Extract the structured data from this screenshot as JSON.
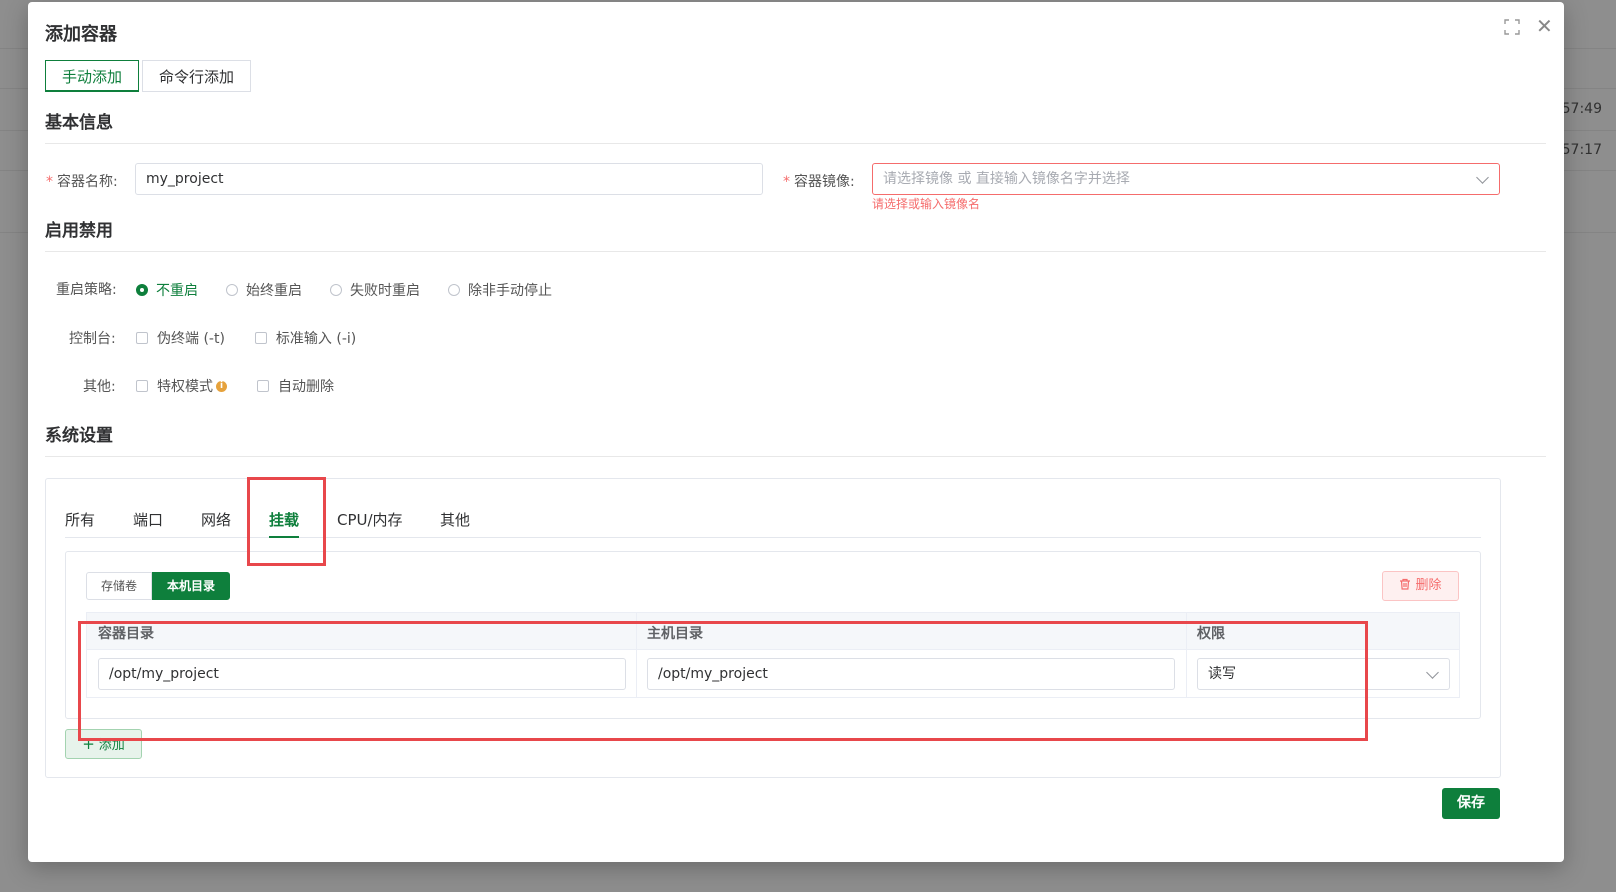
{
  "background": {
    "times": [
      "5:57:49",
      "5:57:17"
    ]
  },
  "dialog": {
    "title": "添加容器",
    "close_icon": "close-icon",
    "fullscreen_icon": "fullscreen-icon",
    "mode_tabs": [
      {
        "label": "手动添加",
        "active": true
      },
      {
        "label": "命令行添加",
        "active": false
      }
    ]
  },
  "basic": {
    "section_title": "基本信息",
    "name_label": "容器名称:",
    "name_value": "my_project",
    "image_label": "容器镜像:",
    "image_placeholder": "请选择镜像 或 直接输入镜像名字并选择",
    "image_error": "请选择或输入镜像名"
  },
  "startup": {
    "section_title": "启用禁用",
    "restart_label": "重启策略:",
    "restart_options": [
      {
        "label": "不重启",
        "checked": true
      },
      {
        "label": "始终重启",
        "checked": false
      },
      {
        "label": "失败时重启",
        "checked": false
      },
      {
        "label": "除非手动停止",
        "checked": false
      }
    ],
    "console_label": "控制台:",
    "console_options": [
      "伪终端 (-t)",
      "标准输入 (-i)"
    ],
    "other_label": "其他:",
    "other_options": [
      "特权模式",
      "自动删除"
    ]
  },
  "system": {
    "section_title": "系统设置",
    "tabs": [
      {
        "label": "所有",
        "active": false
      },
      {
        "label": "端口",
        "active": false
      },
      {
        "label": "网络",
        "active": false
      },
      {
        "label": "挂载",
        "active": true
      },
      {
        "label": "CPU/内存",
        "active": false
      },
      {
        "label": "其他",
        "active": false
      }
    ],
    "mount": {
      "segments": [
        {
          "label": "存储卷",
          "active": false
        },
        {
          "label": "本机目录",
          "active": true
        }
      ],
      "delete_label": "删除",
      "columns": [
        "容器目录",
        "主机目录",
        "权限"
      ],
      "rows": [
        {
          "container_dir": "/opt/my_project",
          "host_dir": "/opt/my_project",
          "permission": "读写"
        }
      ],
      "add_label": "添加"
    }
  },
  "footer": {
    "save_label": "保存"
  },
  "colors": {
    "accent": "#0e7f3c",
    "error": "#f56c6c",
    "highlight": "#e8474b"
  }
}
